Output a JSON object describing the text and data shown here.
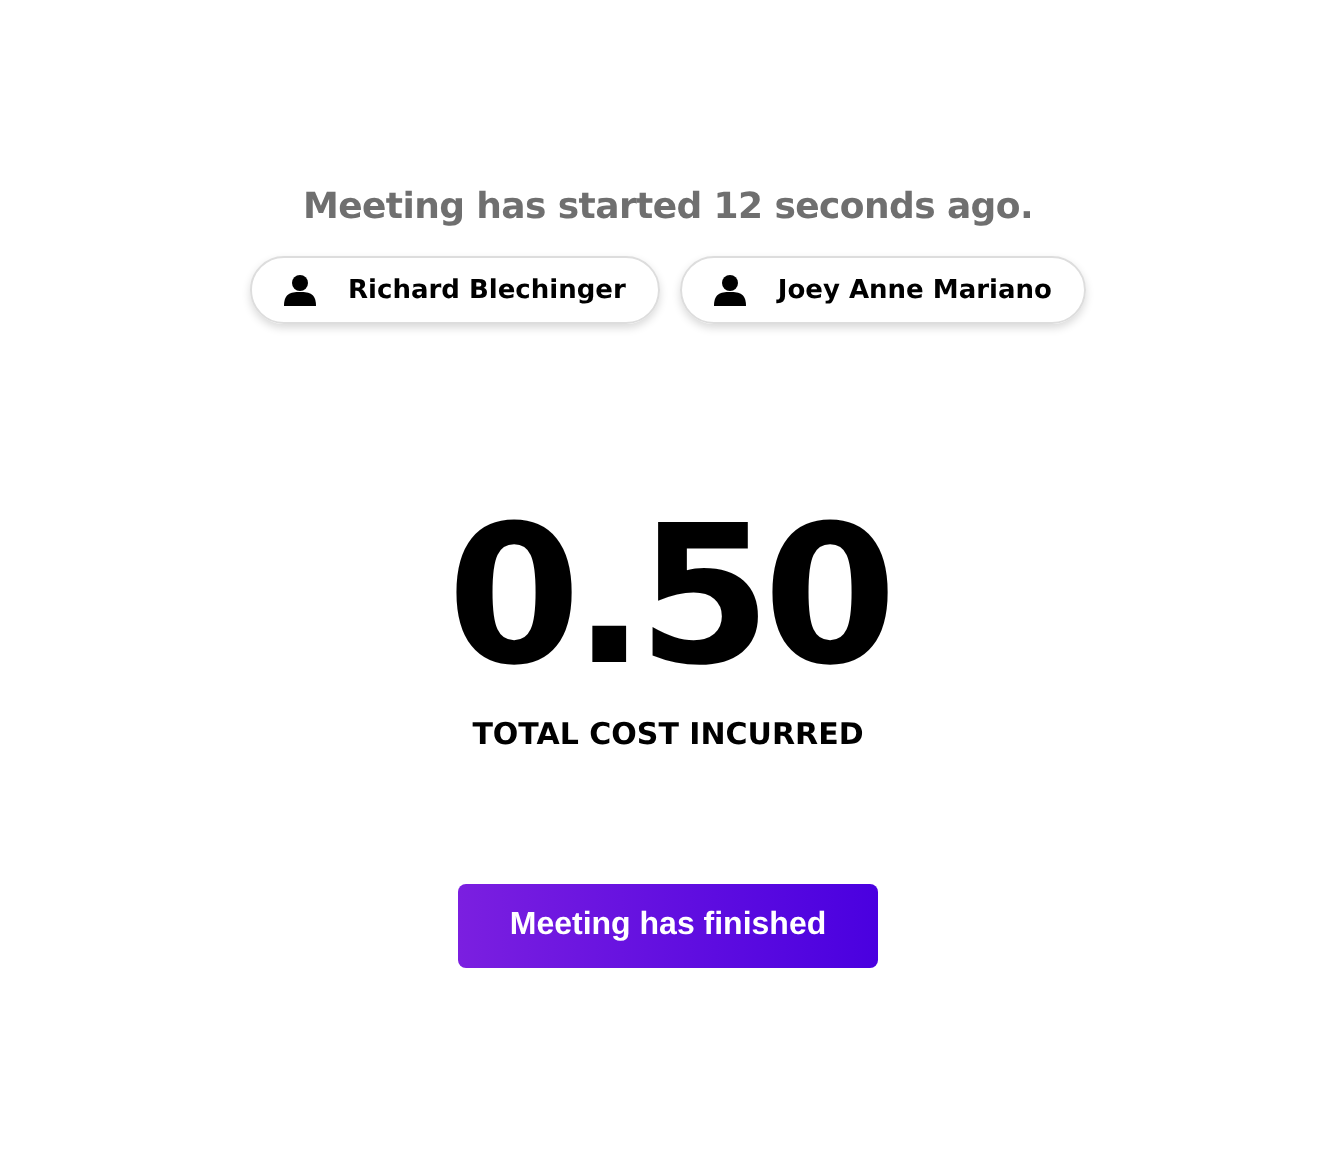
{
  "status": "Meeting has started 12 seconds ago.",
  "participants": [
    {
      "name": "Richard Blechinger"
    },
    {
      "name": "Joey Anne Mariano"
    }
  ],
  "cost": "0.50",
  "cost_label": "TOTAL COST INCURRED",
  "button": "Meeting has finished"
}
